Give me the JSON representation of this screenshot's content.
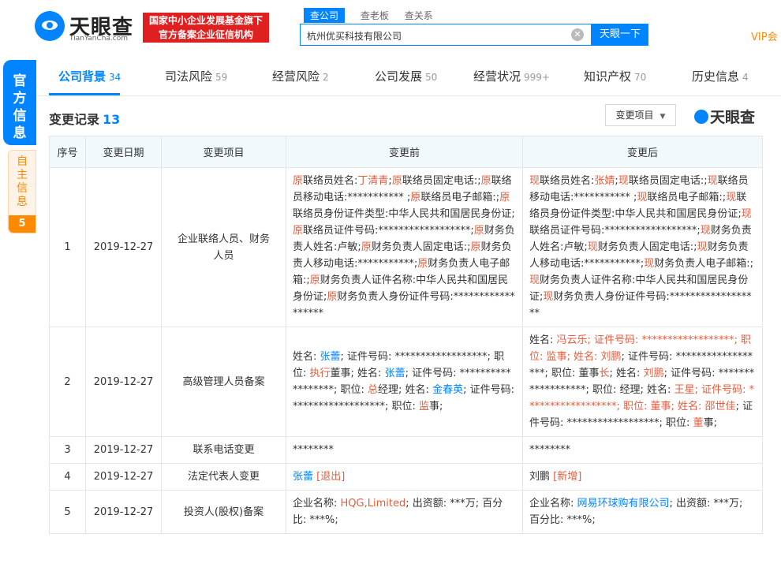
{
  "header": {
    "logo_text": "天眼查",
    "logo_sub": "TianYanCha.com",
    "badge_line1": "国家中小企业发展基金旗下",
    "badge_line2": "官方备案企业征信机构",
    "search_tabs": [
      "查公司",
      "查老板",
      "查关系"
    ],
    "search_value": "杭州优买科技有限公司",
    "search_button": "天眼一下",
    "vip_text": "VIP会"
  },
  "side": {
    "official_label": "官方信息",
    "self_label": "自主信息",
    "self_count": "5"
  },
  "nav": {
    "items": [
      {
        "label": "公司背景",
        "count": "34"
      },
      {
        "label": "司法风险",
        "count": "59"
      },
      {
        "label": "经营风险",
        "count": "2"
      },
      {
        "label": "公司发展",
        "count": "50"
      },
      {
        "label": "经营状况",
        "count": "999+"
      },
      {
        "label": "知识产权",
        "count": "70"
      },
      {
        "label": "历史信息",
        "count": "4"
      }
    ]
  },
  "section": {
    "title": "变更记录",
    "count": "13",
    "filter_label": "变更项目",
    "brand": "天眼查"
  },
  "table": {
    "headers": [
      "序号",
      "变更日期",
      "变更项目",
      "变更前",
      "变更后"
    ],
    "rows": [
      {
        "no": "1",
        "date": "2019-12-27",
        "item": "企业联络人员、财务人员",
        "before": [
          [
            "原",
            "r"
          ],
          [
            "联络员姓名:",
            ""
          ],
          [
            "丁清青",
            "r"
          ],
          [
            ";",
            ""
          ],
          [
            "原",
            "r"
          ],
          [
            "联络员固定电话:;",
            ""
          ],
          [
            "原",
            "r"
          ],
          [
            "联络员移动电话:*********** ;",
            ""
          ],
          [
            "原",
            "r"
          ],
          [
            "联络员电子邮箱:;",
            ""
          ],
          [
            "原",
            "r"
          ],
          [
            "联络员身份证件类型:中华人民共和国居民身份证;",
            ""
          ],
          [
            "原",
            "r"
          ],
          [
            "联络员证件号码:******************;",
            ""
          ],
          [
            "原",
            "r"
          ],
          [
            "财务负责人姓名:卢敏;",
            ""
          ],
          [
            "原",
            "r"
          ],
          [
            "财务负责人固定电话:;",
            ""
          ],
          [
            "原",
            "r"
          ],
          [
            "财务负责人移动电话:***********;",
            ""
          ],
          [
            "原",
            "r"
          ],
          [
            "财务负责人电子邮箱:;",
            ""
          ],
          [
            "原",
            "r"
          ],
          [
            "财务负责人证件名称:中华人民共和国居民身份证;",
            ""
          ],
          [
            "原",
            "r"
          ],
          [
            "财务负责人身份证件号码:******************",
            ""
          ]
        ],
        "after": [
          [
            "现",
            "r"
          ],
          [
            "联络员姓名:",
            ""
          ],
          [
            "张婧",
            "r"
          ],
          [
            ";",
            ""
          ],
          [
            "现",
            "r"
          ],
          [
            "联络员固定电话:;",
            ""
          ],
          [
            "现",
            "r"
          ],
          [
            "联络员移动电话:*********** ;",
            ""
          ],
          [
            "现",
            "r"
          ],
          [
            "联络员电子邮箱:;",
            ""
          ],
          [
            "现",
            "r"
          ],
          [
            "联络员身份证件类型:中华人民共和国居民身份证;",
            ""
          ],
          [
            "现",
            "r"
          ],
          [
            "联络员证件号码:******************;",
            ""
          ],
          [
            "现",
            "r"
          ],
          [
            "财务负责人姓名:卢敏;",
            ""
          ],
          [
            "现",
            "r"
          ],
          [
            "财务负责人固定电话:;",
            ""
          ],
          [
            "现",
            "r"
          ],
          [
            "财务负责人移动电话:***********;",
            ""
          ],
          [
            "现",
            "r"
          ],
          [
            "财务负责人电子邮箱:;",
            ""
          ],
          [
            "现",
            "r"
          ],
          [
            "财务负责人证件名称:中华人民共和国居民身份证;",
            ""
          ],
          [
            "现",
            "r"
          ],
          [
            "财务负责人身份证件号码:******************",
            ""
          ]
        ]
      },
      {
        "no": "2",
        "date": "2019-12-27",
        "item": "高级管理人员备案",
        "before": [
          [
            "姓名: ",
            ""
          ],
          [
            "张蕾",
            "b"
          ],
          [
            "; 证件号码: ******************; 职位: ",
            ""
          ],
          [
            "执行",
            "r"
          ],
          [
            "董事; 姓名: ",
            ""
          ],
          [
            "张蕾",
            "b"
          ],
          [
            "; 证件号码: ******************; 职位: ",
            ""
          ],
          [
            "总",
            "r"
          ],
          [
            "经理; 姓名: ",
            ""
          ],
          [
            "金春英",
            "b"
          ],
          [
            "; 证件号码: ******************; 职位: ",
            ""
          ],
          [
            "监",
            "r"
          ],
          [
            "事;",
            ""
          ]
        ],
        "after": [
          [
            "姓名: ",
            ""
          ],
          [
            "冯云乐; 证件号码: ******************; 职位: 监事; 姓名: 刘鹏",
            "r"
          ],
          [
            "; 证件号码: ******************; 职位: 董事",
            ""
          ],
          [
            "长",
            "r"
          ],
          [
            "; 姓名: ",
            ""
          ],
          [
            "刘鹏",
            "r"
          ],
          [
            "; 证件号码: ******************; 职位: 经理; 姓名: ",
            ""
          ],
          [
            "王星; 证件号码: ******************; 职位: 董事; 姓名: 邵世佳",
            "r"
          ],
          [
            "; 证件号码: ******************; 职位: ",
            ""
          ],
          [
            "董",
            "r"
          ],
          [
            "事;",
            ""
          ]
        ]
      },
      {
        "no": "3",
        "date": "2019-12-27",
        "item": "联系电话变更",
        "before": [
          [
            "********",
            ""
          ]
        ],
        "after": [
          [
            "********",
            ""
          ]
        ]
      },
      {
        "no": "4",
        "date": "2019-12-27",
        "item": "法定代表人变更",
        "before": [
          [
            "张蕾",
            "b"
          ],
          [
            " ",
            ""
          ],
          [
            "[退出]",
            "r"
          ]
        ],
        "after": [
          [
            "刘鹏",
            ""
          ],
          [
            " ",
            ""
          ],
          [
            "[新增]",
            "r"
          ]
        ]
      },
      {
        "no": "5",
        "date": "2019-12-27",
        "item": "投资人(股权)备案",
        "before": [
          [
            "企业名称: ",
            ""
          ],
          [
            "HQG,Limited",
            "r"
          ],
          [
            "; 出资额: ***万; 百分比: ***%;",
            ""
          ]
        ],
        "after": [
          [
            "企业名称: ",
            ""
          ],
          [
            "网易环球购有限公司",
            "b"
          ],
          [
            "; 出资额: ***万; 百分比: ***%;",
            ""
          ]
        ]
      }
    ]
  },
  "colors": {
    "accent": "#0084ff",
    "highlight": "#e65c3c",
    "badge": "#e02020",
    "vip": "#ff8a00"
  }
}
